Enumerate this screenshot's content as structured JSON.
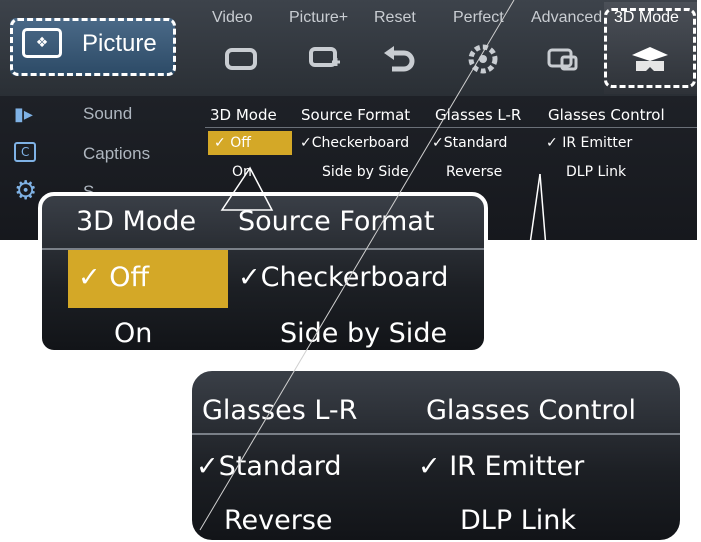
{
  "top_tabs": {
    "picture": "Picture",
    "video": "Video",
    "picture_plus": "Picture+",
    "reset": "Reset",
    "perfect": "Perfect",
    "advanced": "Advanced",
    "mode_3d": "3D Mode"
  },
  "side_menu": [
    "Sound",
    "Captions",
    "S"
  ],
  "columns": {
    "mode_3d": {
      "header": "3D Mode",
      "options": [
        "Off",
        "On"
      ],
      "checked": "Off"
    },
    "source_format": {
      "header": "Source Format",
      "options": [
        "Checkerboard",
        "Side by Side"
      ],
      "checked": "Checkerboard"
    },
    "glasses_lr": {
      "header": "Glasses L-R",
      "options": [
        "Standard",
        "Reverse"
      ],
      "checked": "Standard"
    },
    "glasses_control": {
      "header": "Glasses Control",
      "options": [
        "IR Emitter",
        "DLP Link"
      ],
      "checked": "IR Emitter"
    }
  },
  "check_mark": "✓",
  "colors": {
    "highlight": "#d4a827",
    "selected_tab": "#3a5a7a",
    "background": "#1e2127"
  },
  "icons": [
    "picture-icon",
    "video-icon",
    "picture-plus-icon",
    "reset-icon",
    "perfect-icon",
    "advanced-icon",
    "3d-glasses-icon",
    "sound-icon",
    "captions-icon",
    "gear-icon"
  ]
}
